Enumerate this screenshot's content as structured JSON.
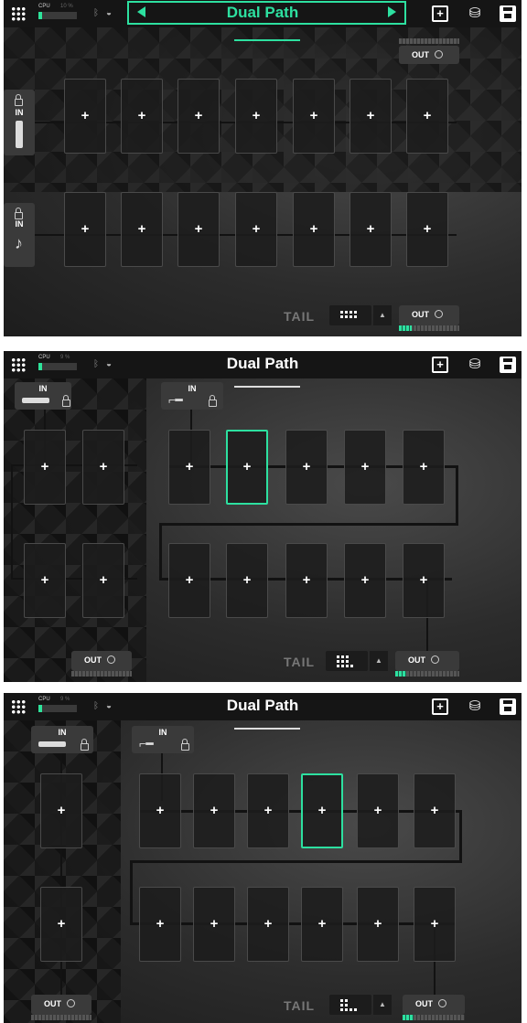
{
  "status": {
    "cpu_label": "CPU",
    "bluetooth_icon": "bluetooth-icon",
    "wifi_icon": "wifi-icon"
  },
  "screens": [
    {
      "cpu_value": "10 %",
      "cpu_fill": 0.1,
      "title": "Dual Path",
      "in1": "IN",
      "in2": "IN",
      "out1": "OUT",
      "out2": "OUT",
      "tail": "TAIL",
      "up": "▲"
    },
    {
      "cpu_value": "9 %",
      "cpu_fill": 0.09,
      "title": "Dual Path",
      "in1": "IN",
      "in2": "IN",
      "out1": "OUT",
      "out2": "OUT",
      "tail": "TAIL",
      "up": "▲"
    },
    {
      "cpu_value": "9 %",
      "cpu_fill": 0.09,
      "title": "Dual Path",
      "in1": "IN",
      "in2": "IN",
      "out1": "OUT",
      "out2": "OUT",
      "tail": "TAIL",
      "up": "▲"
    }
  ],
  "slot_symbol": "+",
  "colors": {
    "accent": "#2de0a0",
    "topbar": "#151515",
    "slot": "#1c1c1c"
  }
}
